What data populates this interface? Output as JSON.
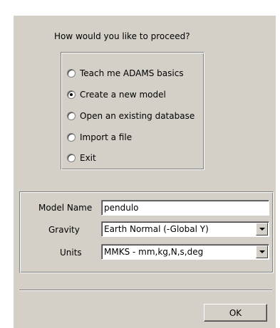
{
  "prompt": "How would you like to proceed?",
  "options": [
    {
      "label": "Teach me ADAMS basics",
      "checked": false
    },
    {
      "label": "Create a new model",
      "checked": true
    },
    {
      "label": "Open an existing database",
      "checked": false
    },
    {
      "label": "Import a file",
      "checked": false
    },
    {
      "label": "Exit",
      "checked": false
    }
  ],
  "form": {
    "model_name_label": "Model Name",
    "model_name_value": "pendulo",
    "gravity_label": "Gravity",
    "gravity_value": "Earth Normal (-Global Y)",
    "units_label": "Units",
    "units_value": "MMKS - mm,kg,N,s,deg"
  },
  "ok_label": "OK",
  "colors": {
    "dialog_bg": "#d4d0c8",
    "field_bg": "#ffffff"
  }
}
